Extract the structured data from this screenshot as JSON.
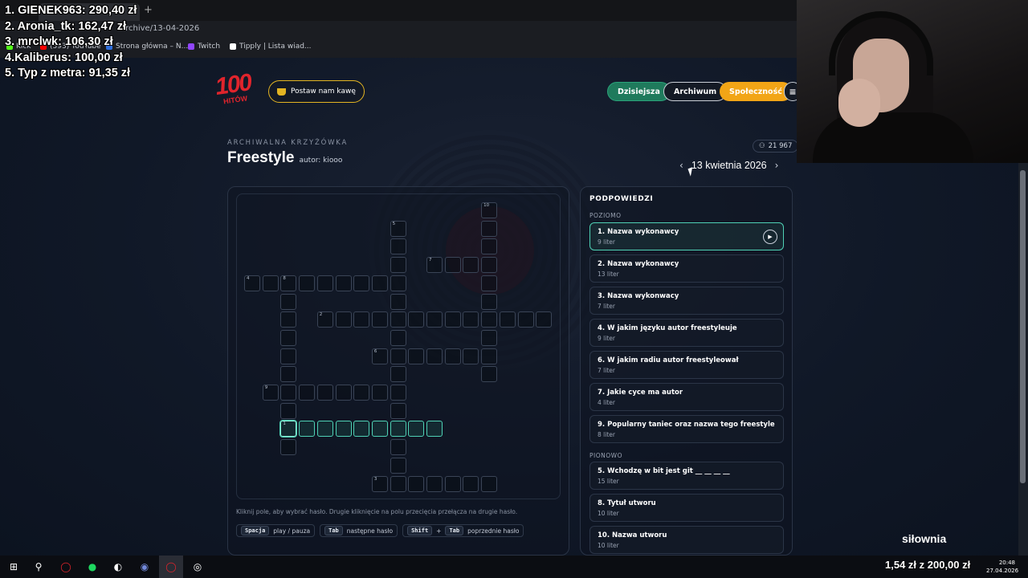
{
  "browser": {
    "url": "archive/13-04-2026",
    "new_tab": "+",
    "bookmarks": [
      {
        "label": "Kick",
        "color": "#53fc18"
      },
      {
        "label": "(393) YouTube",
        "color": "#ff0000"
      },
      {
        "label": "Strona główna – N...",
        "color": "#2f6fdd"
      },
      {
        "label": "Twitch",
        "color": "#9146ff"
      },
      {
        "label": "Tipply | Lista wiad...",
        "color": "#ffffff"
      }
    ]
  },
  "donations": [
    "1. GIENEK963: 290,40 zł",
    "2. Aronia_tk: 162,47 zł",
    "3. mrclwk: 106,30 zł",
    "4.Kaliberus: 100,00 zł",
    "5. Typ z metra: 91,35 zł"
  ],
  "header": {
    "logo_number": "100",
    "logo_text": "HITÓW",
    "coffee_label": "Postaw nam kawę",
    "nav": {
      "today": "Dzisiejsza",
      "archive": "Archiwum",
      "community": "Społeczność",
      "menu": "≡"
    }
  },
  "puzzle": {
    "kicker": "ARCHIWALNA KRZYŻÓWKA",
    "title": "Freestyle",
    "author": "autor: kiooo",
    "players": "21 967",
    "date": "13 kwietnia 2026",
    "prev": "‹",
    "next": "›"
  },
  "help": {
    "text": "Kliknij pole, aby wybrać hasło. Drugie kliknięcie na polu przecięcia przełącza na drugie hasło.",
    "shortcuts": [
      {
        "keys": [
          "Spacja"
        ],
        "action": "play / pauza"
      },
      {
        "keys": [
          "Tab"
        ],
        "action": "następne hasło"
      },
      {
        "keys": [
          "Shift",
          "Tab"
        ],
        "action": "poprzednie hasło"
      }
    ],
    "plus": "+"
  },
  "clues": {
    "title": "PODPOWIEDZI",
    "across_label": "POZIOMO",
    "down_label": "PIONOWO",
    "play_icon": "▶",
    "across": [
      {
        "label": "1. Nazwa wykonawcy",
        "length": "9 liter",
        "selected": true
      },
      {
        "label": "2. Nazwa wykonawcy",
        "length": "13 liter"
      },
      {
        "label": "3. Nazwa wykonwacy",
        "length": "7 liter"
      },
      {
        "label": "4. W jakim języku autor freestyleuje",
        "length": "9 liter"
      },
      {
        "label": "6. W jakim radiu autor freestyleował",
        "length": "7 liter"
      },
      {
        "label": "7. Jakie cyce ma autor",
        "length": "4 liter"
      },
      {
        "label": "9. Popularny taniec oraz nazwa tego freestyle",
        "length": "8 liter"
      }
    ],
    "down": [
      {
        "label": "5. Wchodzę w bit jest git __ __ __ __",
        "length": "15 liter"
      },
      {
        "label": "8. Tytuł utworu",
        "length": "10 liter"
      },
      {
        "label": "10. Nazwa utworu",
        "length": "10 liter"
      }
    ]
  },
  "stream": {
    "gym": "siłownia",
    "goal": "1,54 zł z 200,00 zł"
  },
  "taskbar": {
    "time": "20:48",
    "date": "27.04.2026"
  },
  "colors": {
    "accent_teal": "#4fd1b5",
    "today_green": "#1f7a5c",
    "community_orange": "#f2a516",
    "logo_red": "#e0242c"
  }
}
